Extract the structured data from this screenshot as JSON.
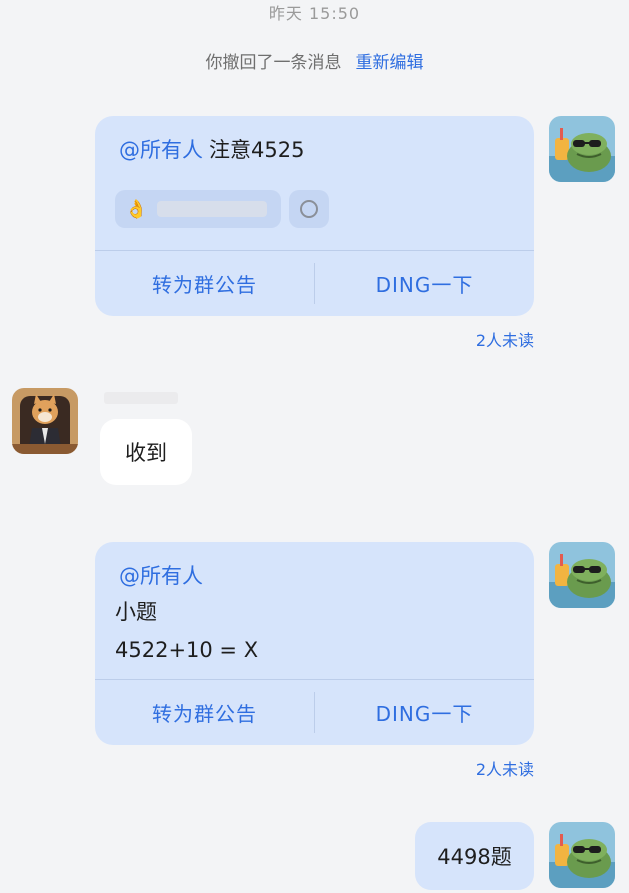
{
  "header": {
    "timestamp": "昨天 15:50",
    "recall_text": "你撤回了一条消息",
    "re_edit_label": "重新编辑"
  },
  "messages": [
    {
      "mention": "@所有人",
      "text": "注意4525",
      "reaction_emoji": "👌",
      "action_announce": "转为群公告",
      "action_ding": "DING一下",
      "unread": "2人未读"
    },
    {
      "reply": "收到"
    },
    {
      "mention": "@所有人",
      "line1": "小题",
      "line2": "4522+10 = X",
      "action_announce": "转为群公告",
      "action_ding": "DING一下",
      "unread": "2人未读"
    },
    {
      "text": "4498题"
    }
  ],
  "colors": {
    "accent": "#2f6ee0",
    "card_bg": "#d6e4fb",
    "page_bg": "#f3f4f6"
  }
}
